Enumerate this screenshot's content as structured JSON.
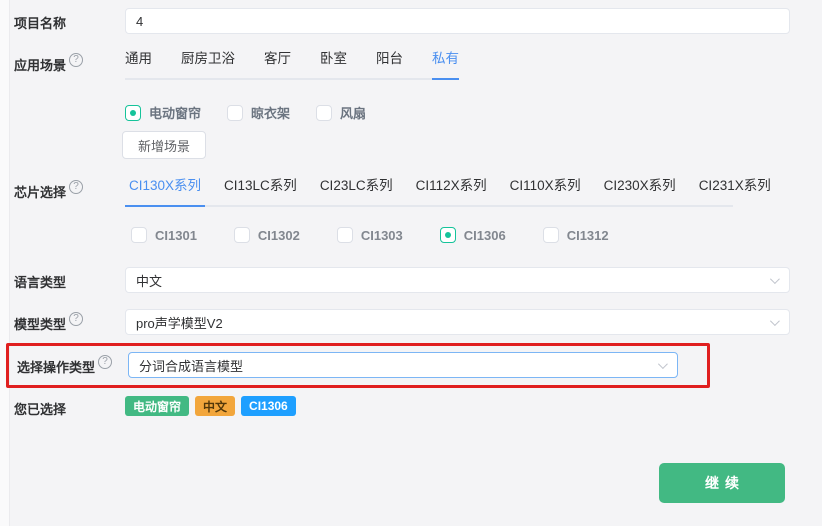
{
  "icons": {
    "help": "?"
  },
  "colors": {
    "accent_blue": "#4a8ff0",
    "success_green": "#15c39a",
    "button_green": "#42b983",
    "annotation_red": "#e01f1f",
    "tag_green": "#42b983",
    "tag_orange": "#f2a63c",
    "tag_blue": "#1e9fff"
  },
  "form": {
    "project_name": {
      "label": "项目名称",
      "value": "4"
    },
    "scene": {
      "label": "应用场景",
      "tabs": [
        "通用",
        "厨房卫浴",
        "客厅",
        "卧室",
        "阳台",
        "私有"
      ],
      "active_tab": "私有",
      "checkboxes": [
        {
          "label": "电动窗帘",
          "checked": true
        },
        {
          "label": "晾衣架",
          "checked": false
        },
        {
          "label": "风扇",
          "checked": false
        }
      ],
      "add_button": "新增场景"
    },
    "chip": {
      "label": "芯片选择",
      "tabs": [
        "CI130X系列",
        "CI13LC系列",
        "CI23LC系列",
        "CI112X系列",
        "CI110X系列",
        "CI230X系列",
        "CI231X系列"
      ],
      "active_tab": "CI130X系列",
      "checkboxes": [
        {
          "label": "CI1301",
          "checked": false
        },
        {
          "label": "CI1302",
          "checked": false
        },
        {
          "label": "CI1303",
          "checked": false
        },
        {
          "label": "CI1306",
          "checked": true
        },
        {
          "label": "CI1312",
          "checked": false
        }
      ]
    },
    "language": {
      "label": "语言类型",
      "value": "中文"
    },
    "model": {
      "label": "模型类型",
      "value": "pro声学模型V2"
    },
    "operation": {
      "label": "选择操作类型",
      "value": "分词合成语言模型"
    },
    "selected": {
      "label": "您已选择",
      "tags": [
        {
          "text": "电动窗帘",
          "color": "#42b983"
        },
        {
          "text": "中文",
          "color": "#f2a63c"
        },
        {
          "text": "CI1306",
          "color": "#1e9fff"
        }
      ]
    },
    "continue_label": "继续"
  }
}
